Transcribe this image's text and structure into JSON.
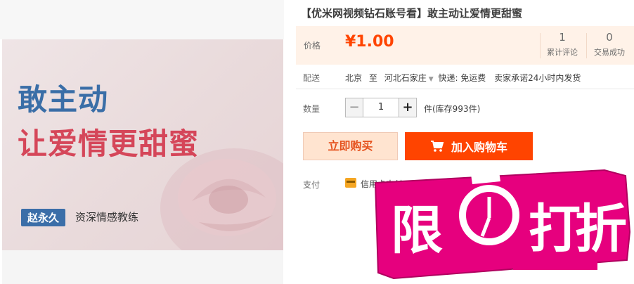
{
  "product_image": {
    "headline_line1": "敢主动",
    "headline_line2": "让爱情更甜蜜",
    "author_name": "赵永久",
    "author_title": "资深情感教练"
  },
  "title": "【优米网视频钻石账号看】敢主动让爱情更甜蜜",
  "price": {
    "label": "价格",
    "value": "¥1.00"
  },
  "stats": {
    "reviews_count": "1",
    "reviews_label": "累计评论",
    "trades_count": "0",
    "trades_label": "交易成功"
  },
  "shipping": {
    "label": "配送",
    "from": "北京",
    "to_word": "至",
    "destination": "河北石家庄",
    "method": "快递: 免运费",
    "promise": "卖家承诺24小时内发货"
  },
  "quantity": {
    "label": "数量",
    "minus": "−",
    "value": "1",
    "plus": "+",
    "stock_text": "件(库存993件)"
  },
  "actions": {
    "buy_now": "立即购买",
    "add_to_cart": "加入购物车"
  },
  "payment": {
    "label": "支付",
    "method_text": "信用卡支付"
  },
  "sticker": {
    "char1": "限",
    "char2": "打",
    "char3": "折"
  },
  "colors": {
    "price_red": "#ff4400",
    "price_bg": "#fff2e8",
    "sticker_magenta": "#e6007e"
  }
}
